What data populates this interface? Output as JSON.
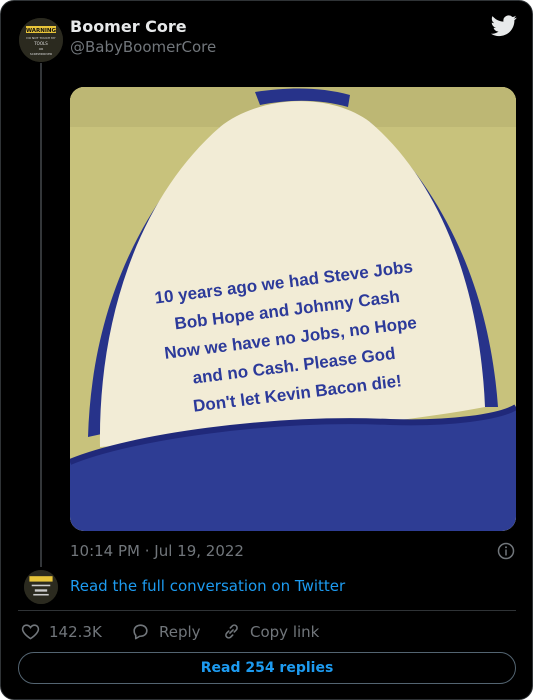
{
  "tweet": {
    "author_name": "Boomer Core",
    "author_handle": "@BabyBoomerCore",
    "timestamp": "10:14 PM · Jul 19, 2022"
  },
  "avatar": {
    "warning": "WARNING",
    "lines": [
      "DO NOT TOUCH MY",
      "TOOLS",
      "OR",
      "SCREWDRIVER"
    ]
  },
  "photo": {
    "hat_text": [
      "10 years ago we had Steve Jobs",
      "Bob Hope and Johnny Cash",
      "Now we have no Jobs, no Hope",
      "and no Cash. Please God",
      "Don't let Kevin Bacon die!"
    ]
  },
  "thread": {
    "full_conversation_link": "Read the full conversation on Twitter"
  },
  "actions": {
    "likes": "142.3K",
    "reply_label": "Reply",
    "copy_link_label": "Copy link"
  },
  "footer": {
    "read_replies_label": "Read 254 replies"
  },
  "colors": {
    "background": "#000000",
    "accent": "#1d9bf0",
    "muted": "#71767b",
    "hat_navy": "#283b8f"
  },
  "icons": {
    "logo": "twitter-bird-icon",
    "info": "info-icon",
    "like": "heart-icon",
    "reply": "reply-icon",
    "copy": "link-icon"
  }
}
